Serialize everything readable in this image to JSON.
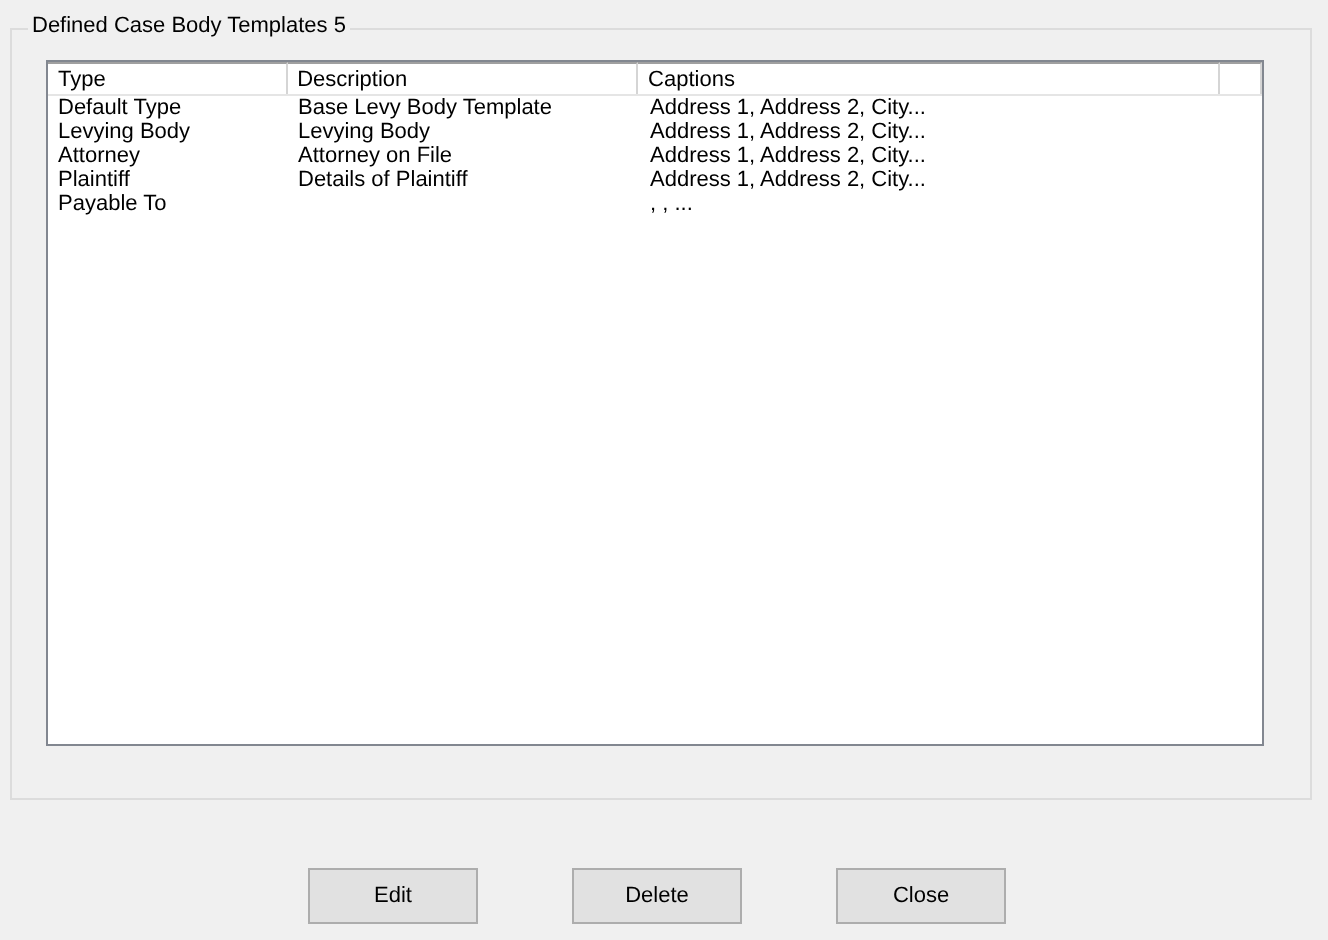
{
  "group": {
    "title": "Defined Case Body Templates 5"
  },
  "table": {
    "columns": [
      "Type",
      "Description",
      "Captions"
    ],
    "rows": [
      [
        "Default Type",
        "Base Levy Body Template",
        "Address 1, Address 2, City..."
      ],
      [
        "Levying Body",
        "Levying Body",
        "Address 1, Address 2, City..."
      ],
      [
        "Attorney",
        "Attorney on File",
        "Address 1, Address 2, City..."
      ],
      [
        "Plaintiff",
        "Details of Plaintiff",
        "Address 1, Address 2, City..."
      ],
      [
        "Payable To",
        "",
        ", , ..."
      ]
    ]
  },
  "buttons": [
    "Edit",
    "Delete",
    "Close"
  ]
}
